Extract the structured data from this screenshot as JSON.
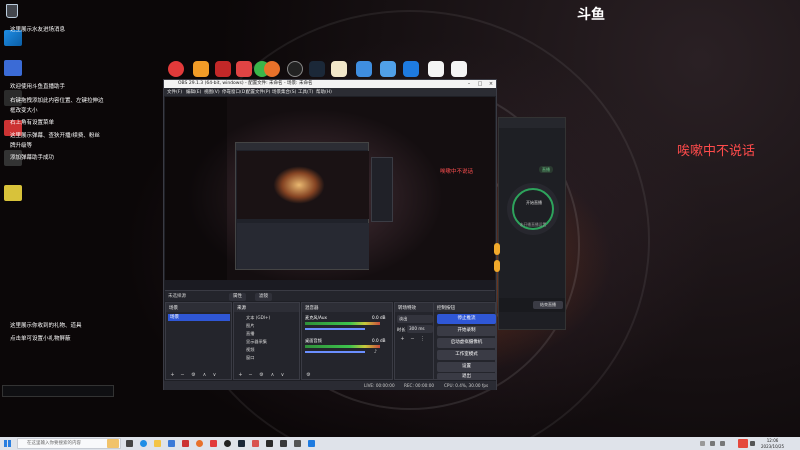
{
  "stream_logo": "斗鱼",
  "stream_overlay_text": "唉嗽中不说话",
  "chat_notices": [
    "这里展示水友进场消息",
    "欢迎使用斗鱼直播助手",
    "右键拖拽添加此内容位置、左键拉伸边",
    "框改变大小",
    "右上角有设置菜单",
    "这里展示弹幕、查狄开播/续费、粉丝",
    "牌升级等",
    "添加弹幕助手成功"
  ],
  "gift_notices": [
    "这里展示你收到的礼物、道具",
    "点击单可设置小礼物屏蔽"
  ],
  "obs": {
    "title": "OBS 29.1.3 (64-bit, windows) - 配置文件: 未命名 - 场景: 未命名",
    "menu": [
      "文件(F)",
      "编辑(E)",
      "视图(V)",
      "停靠窗口(D)",
      "配置文件(P)",
      "场景集合(S)",
      "工具(T)",
      "帮助(H)"
    ],
    "preview_overlay": "唉嗽中不说话",
    "no_source_label": "未选择源",
    "tabs": [
      "属性",
      "滤镜"
    ],
    "docks": {
      "scenes": {
        "title": "场景",
        "items": [
          "场景"
        ]
      },
      "sources": {
        "title": "来源",
        "items": [
          "文本 (GDI+)",
          "图片",
          "直播",
          "显示器采集",
          "视频",
          "窗口"
        ]
      },
      "mixer": {
        "title": "混音器",
        "channels": [
          {
            "name": "麦克风/Aux",
            "db": "0.0 dB"
          },
          {
            "name": "桌面音频",
            "db": "0.0 dB"
          }
        ]
      },
      "transitions": {
        "title": "转场特效",
        "type": "淡出",
        "duration_label": "时长",
        "duration": "300 ms"
      },
      "controls": {
        "title": "控制按钮",
        "buttons": [
          "停止推流",
          "开始录制",
          "启动虚拟摄像机",
          "工作室模式",
          "设置",
          "退出"
        ]
      }
    },
    "status": {
      "live": "LIVE: 00:00:00",
      "rec": "REC: 00:00:00",
      "cpu": "CPU: 0.4%, 30.00 fps"
    }
  },
  "assistant": {
    "status_pill": "直播",
    "ring_label": "开始直播",
    "ring_sub": "未开播直播设置",
    "bottom_button": "结束直播"
  },
  "taskbar": {
    "search_placeholder": "在这里输入你要搜索的内容",
    "time": "12:06",
    "date": "2023/10/25"
  },
  "colors": {
    "obs_primary": "#2f57d6",
    "overlay_red": "#ff4b4b",
    "assistant_green": "#2ea35c"
  }
}
